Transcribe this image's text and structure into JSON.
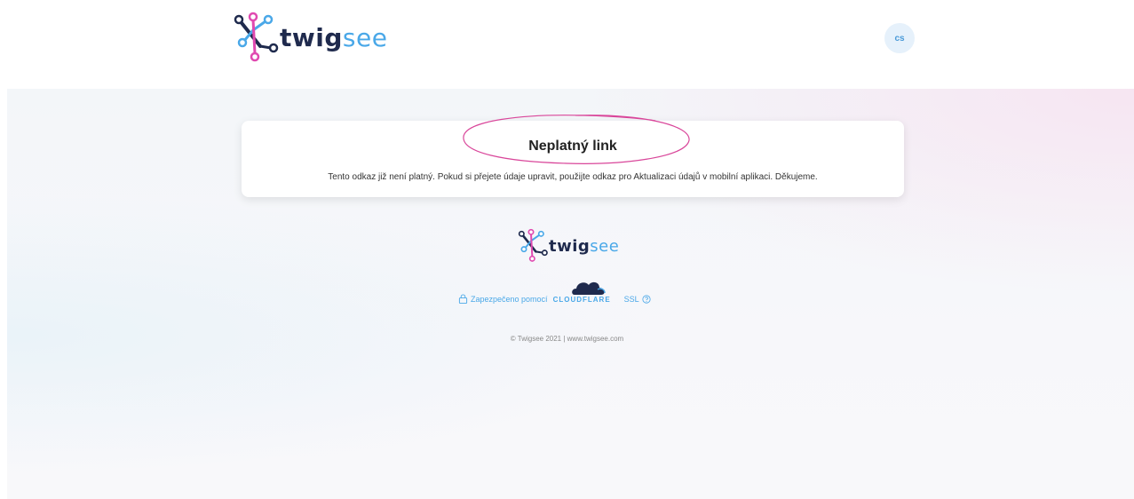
{
  "header": {
    "brand_primary": "twig",
    "brand_secondary": "see",
    "language": "cs"
  },
  "card": {
    "title": "Neplatný link",
    "message": "Tento odkaz již není platný. Pokud si přejete údaje upravit, použijte odkaz pro Aktualizaci údajů v mobilní aplikaci. Děkujeme."
  },
  "footer": {
    "brand_primary": "twig",
    "brand_secondary": "see",
    "secured_label": "Zapezpečeno pomocí",
    "cloudflare_label": "CLOUDFLARE",
    "ssl_label": "SSL",
    "copyright": "© Twigsee 2021 | www.twigsee.com"
  },
  "colors": {
    "brand_dark": "#1f2a4d",
    "brand_blue": "#4aa8e8",
    "brand_pink": "#e04ab0",
    "annotation_pink": "#d9469a"
  },
  "icons": [
    "twigsee-logo-icon",
    "lock-icon",
    "cloud-icon",
    "help-icon"
  ]
}
